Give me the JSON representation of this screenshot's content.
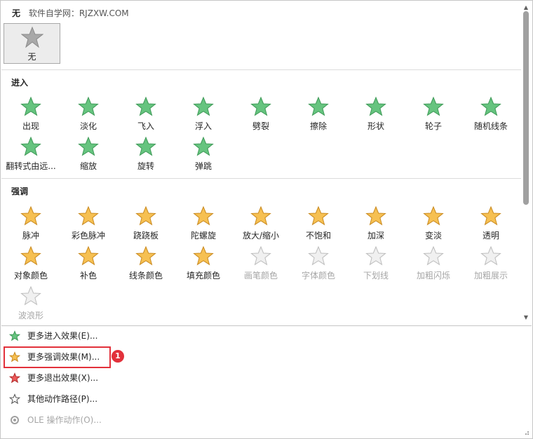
{
  "header": {
    "none_label": "无",
    "watermark": "软件自学网：RJZXW.COM"
  },
  "none_tile": {
    "label": "无"
  },
  "sections": {
    "entrance": {
      "title": "进入",
      "items": [
        {
          "label": "出现",
          "icon": "star-entrance-appear"
        },
        {
          "label": "淡化",
          "icon": "star-entrance-fade"
        },
        {
          "label": "飞入",
          "icon": "star-entrance-fly-in"
        },
        {
          "label": "浮入",
          "icon": "star-entrance-float-in"
        },
        {
          "label": "劈裂",
          "icon": "star-entrance-split"
        },
        {
          "label": "擦除",
          "icon": "star-entrance-wipe"
        },
        {
          "label": "形状",
          "icon": "star-entrance-shape"
        },
        {
          "label": "轮子",
          "icon": "star-entrance-wheel"
        },
        {
          "label": "随机线条",
          "icon": "star-entrance-random-bars"
        },
        {
          "label": "翻转式由远...",
          "icon": "star-entrance-grow-turn"
        },
        {
          "label": "缩放",
          "icon": "star-entrance-zoom"
        },
        {
          "label": "旋转",
          "icon": "star-entrance-swivel"
        },
        {
          "label": "弹跳",
          "icon": "star-entrance-bounce"
        }
      ]
    },
    "emphasis": {
      "title": "强调",
      "items": [
        {
          "label": "脉冲",
          "icon": "star-emphasis-pulse"
        },
        {
          "label": "彩色脉冲",
          "icon": "star-emphasis-color-pulse"
        },
        {
          "label": "跷跷板",
          "icon": "star-emphasis-teeter"
        },
        {
          "label": "陀螺旋",
          "icon": "star-emphasis-spin"
        },
        {
          "label": "放大/缩小",
          "icon": "star-emphasis-grow-shrink"
        },
        {
          "label": "不饱和",
          "icon": "star-emphasis-desaturate"
        },
        {
          "label": "加深",
          "icon": "star-emphasis-darken"
        },
        {
          "label": "变淡",
          "icon": "star-emphasis-lighten"
        },
        {
          "label": "透明",
          "icon": "star-emphasis-transparency"
        },
        {
          "label": "对象颜色",
          "icon": "star-emphasis-object-color"
        },
        {
          "label": "补色",
          "icon": "star-emphasis-complementary"
        },
        {
          "label": "线条颜色",
          "icon": "star-emphasis-line-color"
        },
        {
          "label": "填充颜色",
          "icon": "star-emphasis-fill-color"
        },
        {
          "label": "画笔颜色",
          "icon": "star-emphasis-brush-color",
          "disabled": true
        },
        {
          "label": "字体颜色",
          "icon": "star-emphasis-font-color",
          "disabled": true
        },
        {
          "label": "下划线",
          "icon": "star-emphasis-underline",
          "disabled": true
        },
        {
          "label": "加粗闪烁",
          "icon": "star-emphasis-bold-flash",
          "disabled": true
        },
        {
          "label": "加粗展示",
          "icon": "star-emphasis-bold-reveal",
          "disabled": true
        },
        {
          "label": "波浪形",
          "icon": "star-emphasis-wave",
          "disabled": true
        }
      ]
    }
  },
  "menu": {
    "items": [
      {
        "label": "更多进入效果(E)...",
        "icon": "green-star-icon",
        "disabled": false
      },
      {
        "label": "更多强调效果(M)...",
        "icon": "gold-star-icon",
        "disabled": false
      },
      {
        "label": "更多退出效果(X)...",
        "icon": "red-star-icon",
        "disabled": false
      },
      {
        "label": "其他动作路径(P)...",
        "icon": "outline-star-icon",
        "disabled": false
      },
      {
        "label": "OLE 操作动作(O)...",
        "icon": "gear-icon",
        "disabled": true
      }
    ]
  },
  "annotation": {
    "badge_number": "1"
  },
  "colors": {
    "green": "#5fbf7a",
    "gold": "#f5b84a",
    "red": "#e2313b",
    "gray": "#bdbdbd"
  }
}
